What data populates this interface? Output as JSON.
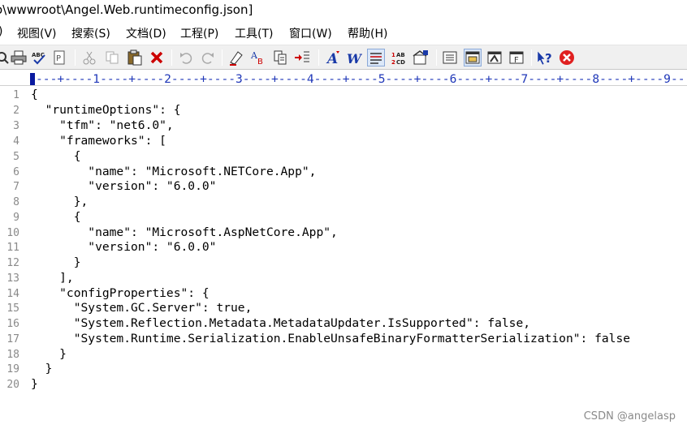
{
  "window": {
    "title": "o\\wwwroot\\Angel.Web.runtimeconfig.json]"
  },
  "menu": {
    "items": [
      {
        "label": ")"
      },
      {
        "label": "视图(V)"
      },
      {
        "label": "搜索(S)"
      },
      {
        "label": "文档(D)"
      },
      {
        "label": "工程(P)"
      },
      {
        "label": "工具(T)"
      },
      {
        "label": "窗口(W)"
      },
      {
        "label": "帮助(H)"
      }
    ]
  },
  "toolbar": {
    "icons": [
      "print-preview-icon",
      "print-icon",
      "spell-check-icon",
      "page-setup-icon",
      "cut-icon",
      "copy-icon",
      "paste-icon",
      "delete-icon",
      "undo-icon",
      "redo-icon",
      "highlight-icon",
      "replace-font-icon",
      "duplicate-icon",
      "indent-icon",
      "italic-a-icon",
      "bold-w-icon",
      "word-wrap-icon",
      "line-numbers-icon",
      "workspace-icon",
      "list-view-icon",
      "output-window-icon",
      "toggle-panel-icon",
      "function-list-icon",
      "context-help-icon",
      "close-document-icon"
    ],
    "colors": {
      "delete": "#cc0000",
      "close": "#e02020",
      "accent": "#1a3aa8"
    }
  },
  "ruler": {
    "text": "---+----1----+----2----+----3----+----4----+----5----+----6----+----7----+----8----+----9---"
  },
  "editor": {
    "lines": [
      {
        "num": "1",
        "text": "{"
      },
      {
        "num": "2",
        "text": "  \"runtimeOptions\": {"
      },
      {
        "num": "3",
        "text": "    \"tfm\": \"net6.0\","
      },
      {
        "num": "4",
        "text": "    \"frameworks\": ["
      },
      {
        "num": "5",
        "text": "      {"
      },
      {
        "num": "6",
        "text": "        \"name\": \"Microsoft.NETCore.App\","
      },
      {
        "num": "7",
        "text": "        \"version\": \"6.0.0\""
      },
      {
        "num": "8",
        "text": "      },"
      },
      {
        "num": "9",
        "text": "      {"
      },
      {
        "num": "10",
        "text": "        \"name\": \"Microsoft.AspNetCore.App\","
      },
      {
        "num": "11",
        "text": "        \"version\": \"6.0.0\""
      },
      {
        "num": "12",
        "text": "      }"
      },
      {
        "num": "13",
        "text": "    ],"
      },
      {
        "num": "14",
        "text": "    \"configProperties\": {"
      },
      {
        "num": "15",
        "text": "      \"System.GC.Server\": true,"
      },
      {
        "num": "16",
        "text": "      \"System.Reflection.Metadata.MetadataUpdater.IsSupported\": false,"
      },
      {
        "num": "17",
        "text": "      \"System.Runtime.Serialization.EnableUnsafeBinaryFormatterSerialization\": false"
      },
      {
        "num": "18",
        "text": "    }"
      },
      {
        "num": "19",
        "text": "  }"
      },
      {
        "num": "20",
        "text": "}"
      }
    ]
  },
  "watermark": {
    "text": "CSDN @angelasp"
  }
}
